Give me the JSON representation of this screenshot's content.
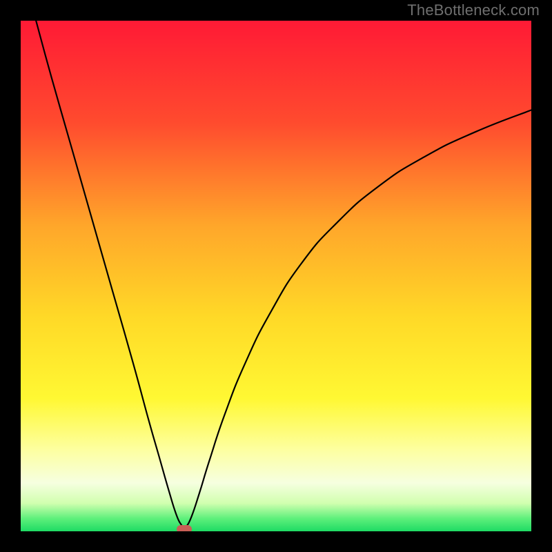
{
  "watermark": {
    "text": "TheBottleneck.com"
  },
  "colors": {
    "frame_bg": "#000000",
    "watermark": "#6f6f6f",
    "curve": "#000000",
    "marker": "#c95f56",
    "gradient_stops": [
      {
        "offset": 0.0,
        "color": "#ff1a35"
      },
      {
        "offset": 0.2,
        "color": "#ff4b2e"
      },
      {
        "offset": 0.4,
        "color": "#ffa62a"
      },
      {
        "offset": 0.58,
        "color": "#ffd927"
      },
      {
        "offset": 0.74,
        "color": "#fff833"
      },
      {
        "offset": 0.84,
        "color": "#fdffa0"
      },
      {
        "offset": 0.905,
        "color": "#f6ffe0"
      },
      {
        "offset": 0.945,
        "color": "#d1ffaf"
      },
      {
        "offset": 0.975,
        "color": "#5ef07b"
      },
      {
        "offset": 1.0,
        "color": "#1edb64"
      }
    ]
  },
  "chart_data": {
    "type": "line",
    "title": "",
    "xlabel": "",
    "ylabel": "",
    "xlim": [
      0,
      100
    ],
    "ylim": [
      0,
      100
    ],
    "grid": false,
    "legend": false,
    "series": [
      {
        "name": "bottleneck-curve",
        "x": [
          3,
          6,
          10,
          14,
          18,
          22,
          25,
          27,
          29,
          30.5,
          31.5,
          32,
          32.5,
          33.5,
          35,
          37,
          40,
          44,
          49,
          55,
          62,
          70,
          79,
          89,
          100
        ],
        "y": [
          100,
          89,
          75,
          61,
          47,
          33,
          22,
          15,
          8,
          3.2,
          1.2,
          0.6,
          1.0,
          3.0,
          7.5,
          14,
          23,
          33,
          43,
          52.5,
          60.5,
          67.5,
          73.3,
          78.2,
          82.5
        ]
      }
    ],
    "annotations": [
      {
        "name": "min-marker",
        "x": 32,
        "y": 0.4,
        "shape": "pill",
        "color": "#c95f56"
      }
    ]
  }
}
